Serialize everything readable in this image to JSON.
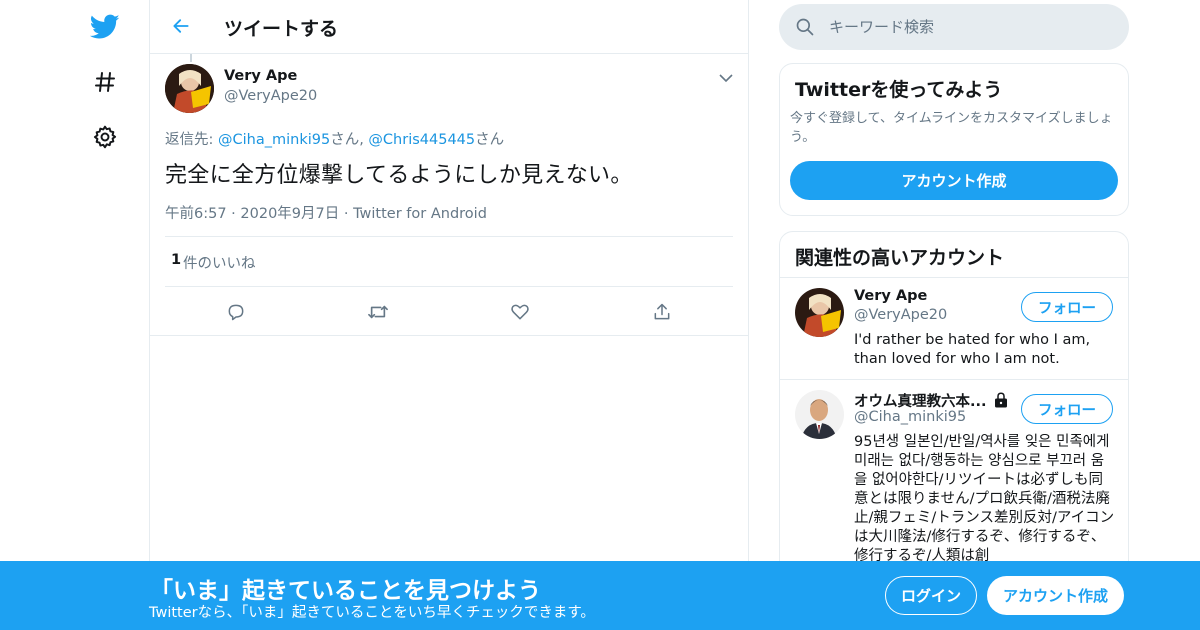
{
  "colors": {
    "accent": "#1da1f2",
    "text": "#14171a",
    "muted": "#657786",
    "border": "#e6ecf0"
  },
  "nav": {
    "logo_icon": "twitter-bird-icon",
    "explore_icon": "hashtag-icon",
    "settings_icon": "gear-icon"
  },
  "header": {
    "title": "ツイートする",
    "back_icon": "arrow-left-icon"
  },
  "tweet": {
    "author_name": "Very Ape",
    "author_handle": "@VeryApe20",
    "reply_prefix": "返信先: ",
    "reply_user1": "@Ciha_minki95",
    "reply_sep": "さん, ",
    "reply_user2": "@Chris445445",
    "reply_suffix": "さん",
    "text": "完全に全方位爆撃してるようにしか見えない。",
    "time": "午前6:57",
    "date": "2020年9月7日",
    "source": "Twitter for Android",
    "like_count": "1",
    "like_label": "件のいいね"
  },
  "search": {
    "placeholder": "キーワード検索"
  },
  "signup_card": {
    "title": "Twitterを使ってみよう",
    "description": "今すぐ登録して、タイムラインをカスタマイズしましょう。",
    "button": "アカウント作成"
  },
  "related": {
    "title": "関連性の高いアカウント",
    "accounts": [
      {
        "name": "Very Ape",
        "handle": "@VeryApe20",
        "bio": "I'd rather be hated for who I am, than loved for who I am not.",
        "follow": "フォロー"
      },
      {
        "name": "オウム真理教六本...",
        "handle": "@Ciha_minki95",
        "bio": "95년생 일본인/반일/역사를 잊은 민족에게 미래는 없다/행동하는 양심으로 부끄러 움을 없어야한다/リツイートは必ずしも同意とは限りません/プロ飲兵衛/酒税法廃止/親フェミ/トランス差別反対/アイコンは大川隆法/修行するぞ、修行するぞ、修行するぞ/人類は創",
        "follow": "フォロー"
      }
    ]
  },
  "bottom_bar": {
    "title": "「いま」起きていることを見つけよう",
    "subtitle": "Twitterなら、「いま」起きていることをいち早くチェックできます。",
    "login": "ログイン",
    "signup": "アカウント作成"
  }
}
